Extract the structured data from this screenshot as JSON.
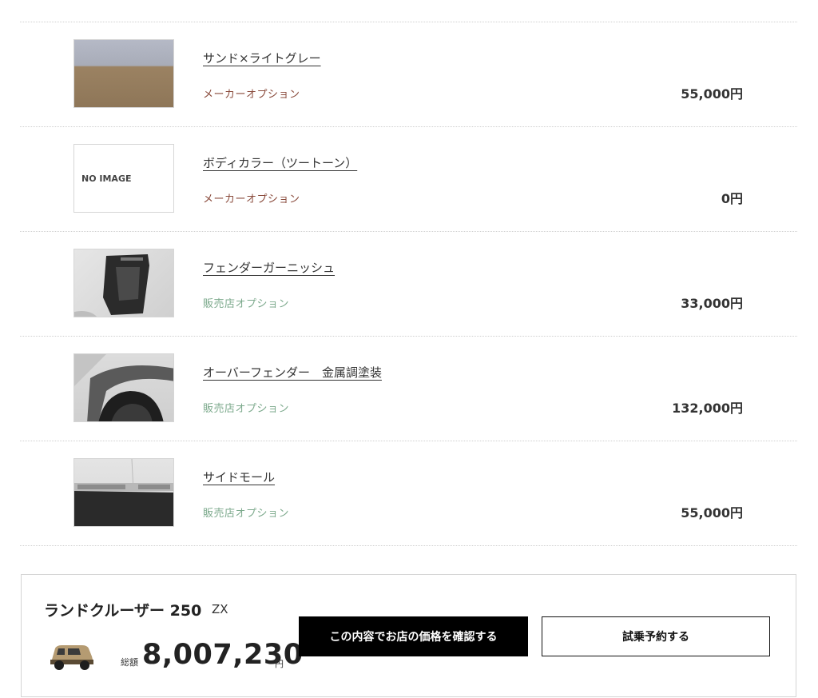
{
  "options": [
    {
      "name": "サンド×ライトグレー",
      "category": "メーカーオプション",
      "category_type": "maker",
      "price": "55,000円",
      "image": "sand-light-gray-swatch",
      "image_text": ""
    },
    {
      "name": "ボディカラー（ツートーン）",
      "category": "メーカーオプション",
      "category_type": "maker",
      "price": "0円",
      "image": "no-image",
      "image_text": "NO IMAGE"
    },
    {
      "name": "フェンダーガーニッシュ",
      "category": "販売店オプション",
      "category_type": "dealer",
      "price": "33,000円",
      "image": "fender-garnish-photo",
      "image_text": ""
    },
    {
      "name": "オーバーフェンダー　金属調塗装",
      "category": "販売店オプション",
      "category_type": "dealer",
      "price": "132,000円",
      "image": "over-fender-photo",
      "image_text": ""
    },
    {
      "name": "サイドモール",
      "category": "販売店オプション",
      "category_type": "dealer",
      "price": "55,000円",
      "image": "side-mole-photo",
      "image_text": ""
    }
  ],
  "summary": {
    "model": "ランドクルーザー 250",
    "grade": "ZX",
    "total_label": "総額",
    "total_value": "8,007,230",
    "currency": "円",
    "primary_button": "この内容でお店の価格を確認する",
    "secondary_button": "試乗予約する"
  },
  "colors": {
    "maker": "#8a4b3c",
    "dealer": "#7daa8d",
    "primary_button_bg": "#000000"
  }
}
